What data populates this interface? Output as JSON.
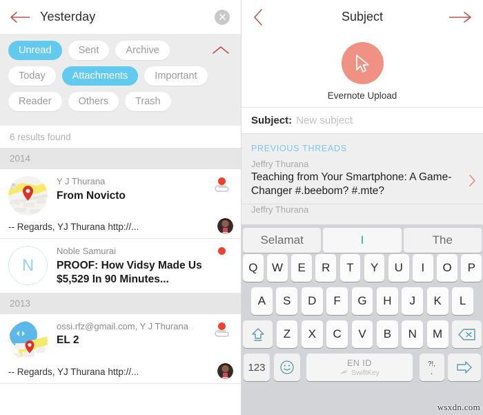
{
  "left": {
    "header": {
      "title": "Yesterday",
      "back_icon": "back-arrow-icon",
      "close_icon": "close-icon"
    },
    "filters": {
      "collapse_icon": "chevron-up-icon",
      "rows": [
        [
          {
            "label": "Unread",
            "active": true
          },
          {
            "label": "Sent",
            "active": false
          },
          {
            "label": "Archive",
            "active": false
          }
        ],
        [
          {
            "label": "Today",
            "active": false
          },
          {
            "label": "Attachments",
            "active": true
          },
          {
            "label": "Important",
            "active": false
          }
        ],
        [
          {
            "label": "Reader",
            "active": false
          },
          {
            "label": "Others",
            "active": false
          },
          {
            "label": "Trash",
            "active": false
          }
        ]
      ]
    },
    "results_text": "6 results found",
    "groups": [
      {
        "year": "2014",
        "items": [
          {
            "thumb": "map-thumbnail",
            "sender": "Y J Thurana",
            "subject": "From Novicto",
            "snippet": "-- Regards, YJ Thurana http://...",
            "unread": true,
            "attachment": true,
            "avatar": "person-photo-avatar"
          },
          {
            "thumb": "letter-avatar",
            "avatar_letter": "N",
            "sender": "Noble Samurai",
            "subject": "PROOF: How Vidsy Made Us $5,529 In 90 Minutes...",
            "snippet": "",
            "unread": true,
            "attachment": false,
            "avatar": ""
          }
        ]
      },
      {
        "year": "2013",
        "items": [
          {
            "thumb": "map-thumbnail-blue",
            "sender": "ossi.rfz@gmail.com, Y J Thurana",
            "subject": "EL 2",
            "snippet": "-- Regards, YJ Thurana http://...",
            "unread": true,
            "attachment": true,
            "avatar": "person-photo-avatar"
          }
        ]
      }
    ]
  },
  "right": {
    "header": {
      "title": "Subject",
      "back_icon": "chevron-left-icon",
      "send_icon": "forward-arrow-icon"
    },
    "attachment": {
      "label": "Evernote Upload",
      "icon": "cursor-arrow-icon",
      "circle_color": "#ef9183"
    },
    "subject_field": {
      "label": "Subject:",
      "value": "",
      "placeholder": "New subject"
    },
    "threads": {
      "header": "PREVIOUS THREADS",
      "items": [
        {
          "sender": "Jeffry Thurana",
          "subject": "Teaching from Your Smartphone: A Game-Changer #.beebom? #.mte?",
          "chevron": "chevron-right-icon"
        },
        {
          "sender": "Jeffry Thurana",
          "subject": "",
          "chevron": ""
        }
      ]
    }
  },
  "keyboard": {
    "suggestions": [
      "Selamat",
      "I",
      "The"
    ],
    "rows": [
      [
        "Q",
        "W",
        "E",
        "R",
        "T",
        "Y",
        "U",
        "I",
        "O",
        "P"
      ],
      [
        "A",
        "S",
        "D",
        "F",
        "G",
        "H",
        "J",
        "K",
        "L"
      ],
      [
        "Z",
        "X",
        "C",
        "V",
        "B",
        "N",
        "M"
      ]
    ],
    "shift_icon": "shift-up-icon",
    "backspace_icon": "backspace-icon",
    "numbers_label": "123",
    "emoji_icon": "smiley-icon",
    "space_lang": "EN ID",
    "space_brand": "SwiftKey",
    "punctuation_top": "?!,",
    "punctuation_bottom": ".",
    "enter_icon": "enter-arrow-icon"
  },
  "watermark": "wsxdn.com"
}
